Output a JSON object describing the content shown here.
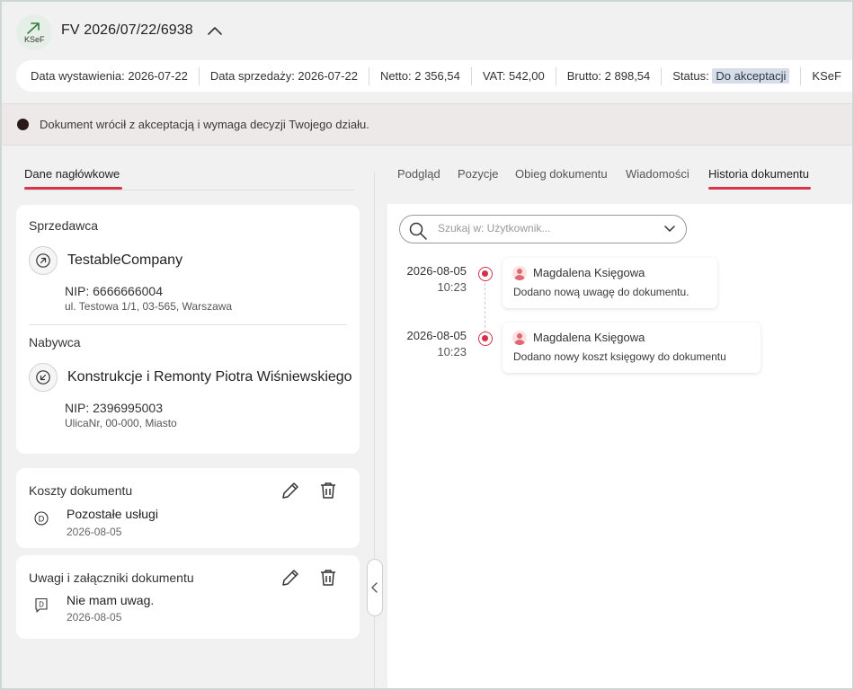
{
  "header": {
    "logo_text": "KSeF",
    "title": "FV 2026/07/22/6938"
  },
  "meta": {
    "issue_date": "Data wystawienia: 2026-07-22",
    "sale_date": "Data sprzedaży: 2026-07-22",
    "netto": "Netto: 2 356,54",
    "vat": "VAT: 542,00",
    "brutto": "Brutto: 2 898,54",
    "status_label": "Status:",
    "status_value": "Do akceptacji",
    "ksef": "KSeF"
  },
  "alert": {
    "text": "Dokument wrócił z akceptacją i wymaga decyzji Twojego działu."
  },
  "left": {
    "tab": "Dane nagłówkowe",
    "seller": {
      "label": "Sprzedawca",
      "name": "TestableCompany",
      "nip": "NIP: 6666666004",
      "address": "ul. Testowa 1/1, 03-565, Warszawa"
    },
    "buyer": {
      "label": "Nabywca",
      "name": "Konstrukcje i Remonty Piotra Wiśniewskiego",
      "nip": "NIP: 2396995003",
      "address": "UlicaNr, 00-000, Miasto"
    },
    "costs": {
      "title": "Koszty dokumentu",
      "item_title": "Pozostałe usługi",
      "item_date": "2026-08-05"
    },
    "notes": {
      "title": "Uwagi i załączniki dokumentu",
      "item_title": "Nie mam uwag.",
      "item_date": "2026-08-05"
    }
  },
  "tabs": [
    "Podgląd",
    "Pozycje",
    "Obieg dokumentu",
    "Wiadomości",
    "Historia dokumentu"
  ],
  "search": {
    "placeholder": "Szukaj w: Użytkownik..."
  },
  "history": [
    {
      "date": "2026-08-05",
      "time": "10:23",
      "user": "Magdalena Księgowa",
      "message": "Dodano nową uwagę do dokumentu."
    },
    {
      "date": "2026-08-05",
      "time": "10:23",
      "user": "Magdalena Księgowa",
      "message": "Dodano nowy koszt księgowy do dokumentu"
    }
  ],
  "colors": {
    "accent": "#d9354a",
    "status_badge_bg": "#d6dde7",
    "alert_dot": "#2a1a17"
  }
}
